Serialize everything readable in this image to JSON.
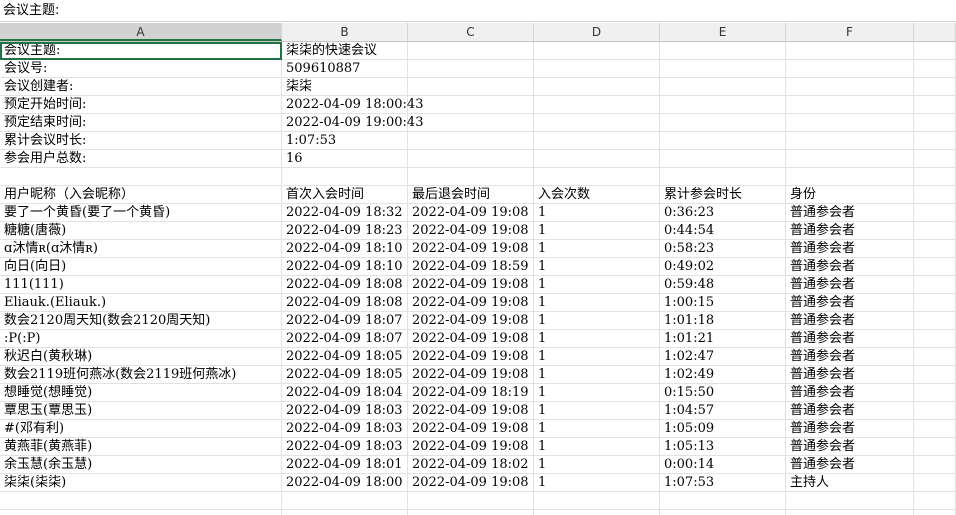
{
  "formula_bar": {
    "content": "会议主题:"
  },
  "columns": [
    "A",
    "B",
    "C",
    "D",
    "E",
    "F"
  ],
  "selected_column": 0,
  "selected_cell": {
    "row": 0,
    "col": 0
  },
  "info_rows": [
    [
      "会议主题:",
      "柒柒的快速会议"
    ],
    [
      "会议号:",
      "509610887"
    ],
    [
      "会议创建者:",
      "柒柒"
    ],
    [
      "预定开始时间:",
      "2022-04-09  18:00:43"
    ],
    [
      "预定结束时间:",
      "2022-04-09  19:00:43"
    ],
    [
      "累计会议时长:",
      "1:07:53"
    ],
    [
      "参会用户总数:",
      "16"
    ]
  ],
  "table_header": [
    "用户昵称（入会昵称）",
    "首次入会时间",
    "最后退会时间",
    "入会次数",
    "累计参会时长",
    "身份"
  ],
  "participants": [
    [
      "要了一个黄昏(要了一个黄昏)",
      "2022-04-09  18:32",
      "2022-04-09  19:08",
      "1",
      "0:36:23",
      "普通参会者"
    ],
    [
      "糖糖(唐薇)",
      "2022-04-09  18:23",
      "2022-04-09  19:08",
      "1",
      "0:44:54",
      "普通参会者"
    ],
    [
      "ɑ沐情ʀ(ɑ沐情ʀ)",
      "2022-04-09  18:10",
      "2022-04-09  19:08",
      "1",
      "0:58:23",
      "普通参会者"
    ],
    [
      "向日(向日)",
      "2022-04-09  18:10",
      "2022-04-09  18:59",
      "1",
      "0:49:02",
      "普通参会者"
    ],
    [
      "111(111)",
      "2022-04-09  18:08",
      "2022-04-09  19:08",
      "1",
      "0:59:48",
      "普通参会者"
    ],
    [
      "Eliauk.(Eliauk.)",
      "2022-04-09  18:08",
      "2022-04-09  19:08",
      "1",
      "1:00:15",
      "普通参会者"
    ],
    [
      "数会2120周天知(数会2120周天知)",
      "2022-04-09  18:07",
      "2022-04-09  19:08",
      "1",
      "1:01:18",
      "普通参会者"
    ],
    [
      ":P(:P)",
      "2022-04-09  18:07",
      "2022-04-09  19:08",
      "1",
      "1:01:21",
      "普通参会者"
    ],
    [
      "秋迟白(黄秋琳)",
      "2022-04-09  18:05",
      "2022-04-09  19:08",
      "1",
      "1:02:47",
      "普通参会者"
    ],
    [
      "数会2119班何燕冰(数会2119班何燕冰)",
      "2022-04-09  18:05",
      "2022-04-09  19:08",
      "1",
      "1:02:49",
      "普通参会者"
    ],
    [
      "想睡觉(想睡觉)",
      "2022-04-09  18:04",
      "2022-04-09  18:19",
      "1",
      "0:15:50",
      "普通参会者"
    ],
    [
      "覃思玉(覃思玉)",
      "2022-04-09  18:03",
      "2022-04-09  19:08",
      "1",
      "1:04:57",
      "普通参会者"
    ],
    [
      "#(邓有利)",
      "2022-04-09  18:03",
      "2022-04-09  19:08",
      "1",
      "1:05:09",
      "普通参会者"
    ],
    [
      "黄燕菲(黄燕菲)",
      "2022-04-09  18:03",
      "2022-04-09  19:08",
      "1",
      "1:05:13",
      "普通参会者"
    ],
    [
      "余玉慧(余玉慧)",
      "2022-04-09  18:01",
      "2022-04-09  18:02",
      "1",
      "0:00:14",
      "普通参会者"
    ],
    [
      "柒柒(柒柒)",
      "2022-04-09  18:00",
      "2022-04-09  19:08",
      "1",
      "1:07:53",
      "主持人"
    ]
  ]
}
